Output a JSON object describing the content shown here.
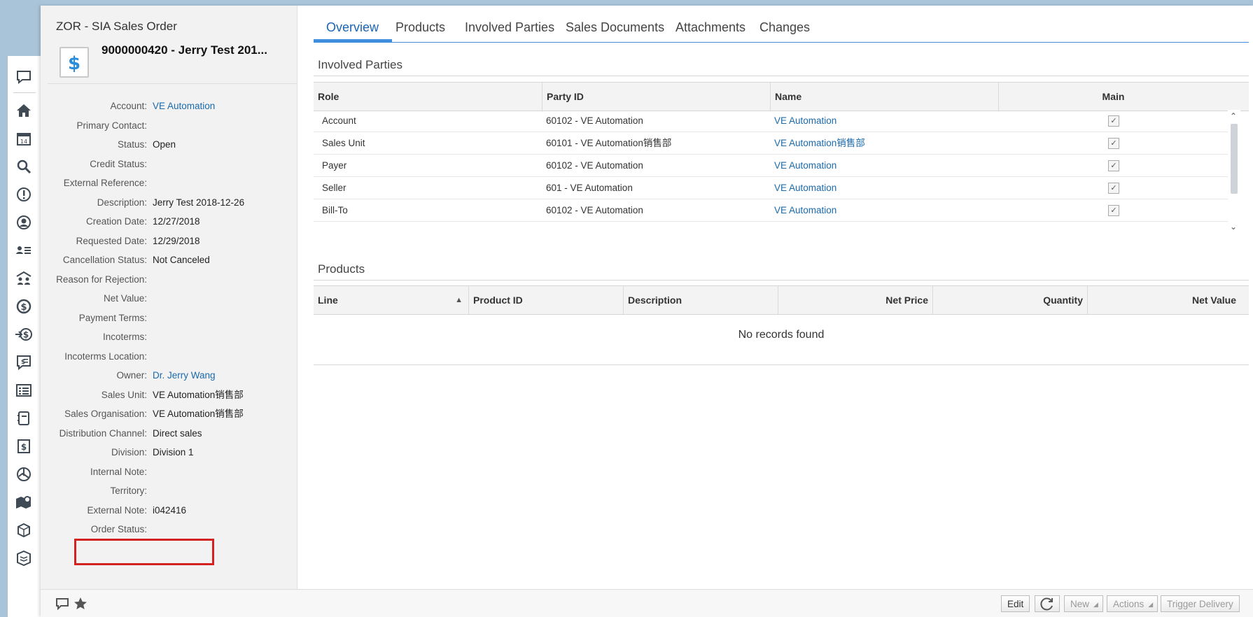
{
  "header": {
    "object_type": "ZOR - SIA Sales Order",
    "title": "9000000420 - Jerry Test 201...",
    "icon": "dollar-document-icon"
  },
  "fields": [
    {
      "label": "Account:",
      "value": "VE Automation",
      "link": true
    },
    {
      "label": "Primary Contact:",
      "value": ""
    },
    {
      "label": "Status:",
      "value": "Open"
    },
    {
      "label": "Credit Status:",
      "value": ""
    },
    {
      "label": "External Reference:",
      "value": ""
    },
    {
      "label": "Description:",
      "value": "Jerry Test 2018-12-26"
    },
    {
      "label": "Creation Date:",
      "value": "12/27/2018"
    },
    {
      "label": "Requested Date:",
      "value": "12/29/2018"
    },
    {
      "label": "Cancellation Status:",
      "value": "Not Canceled"
    },
    {
      "label": "Reason for Rejection:",
      "value": ""
    },
    {
      "label": "Net Value:",
      "value": ""
    },
    {
      "label": "Payment Terms:",
      "value": ""
    },
    {
      "label": "Incoterms:",
      "value": ""
    },
    {
      "label": "Incoterms Location:",
      "value": ""
    },
    {
      "label": "Owner:",
      "value": "Dr. Jerry Wang",
      "link": true
    },
    {
      "label": "Sales Unit:",
      "value": "VE Automation销售部"
    },
    {
      "label": "Sales Organisation:",
      "value": "VE Automation销售部"
    },
    {
      "label": "Distribution Channel:",
      "value": "Direct sales"
    },
    {
      "label": "Division:",
      "value": "Division 1"
    },
    {
      "label": "Internal Note:",
      "value": ""
    },
    {
      "label": "Territory:",
      "value": ""
    },
    {
      "label": "External Note:",
      "value": "i042416"
    },
    {
      "label": "Order Status:",
      "value": ""
    }
  ],
  "tabs": [
    {
      "label": "Overview",
      "active": true
    },
    {
      "label": "Products"
    },
    {
      "label": "Involved Parties"
    },
    {
      "label": "Sales Documents"
    },
    {
      "label": "Attachments"
    },
    {
      "label": "Changes"
    }
  ],
  "involved_parties": {
    "title": "Involved Parties",
    "columns": [
      "Role",
      "Party ID",
      "Name",
      "Main"
    ],
    "rows": [
      {
        "role": "Account",
        "party_id": "60102 - VE Automation",
        "name": "VE Automation",
        "main": true
      },
      {
        "role": "Sales Unit",
        "party_id": "60101 - VE Automation销售部",
        "name": "VE Automation销售部",
        "main": true
      },
      {
        "role": "Payer",
        "party_id": "60102 - VE Automation",
        "name": "VE Automation",
        "main": true
      },
      {
        "role": "Seller",
        "party_id": "601 - VE Automation",
        "name": "VE Automation",
        "main": true
      },
      {
        "role": "Bill-To",
        "party_id": "60102 - VE Automation",
        "name": "VE Automation",
        "main": true
      }
    ]
  },
  "products": {
    "title": "Products",
    "columns": [
      "Line",
      "Product ID",
      "Description",
      "Net Price",
      "Quantity",
      "Net Value"
    ],
    "empty_text": "No records found"
  },
  "toolbar": {
    "edit": "Edit",
    "new": "New",
    "actions": "Actions",
    "trigger_delivery": "Trigger Delivery"
  },
  "colors": {
    "link": "#1a6aad",
    "tab_active": "#1b64b5",
    "highlight": "#d32222"
  }
}
